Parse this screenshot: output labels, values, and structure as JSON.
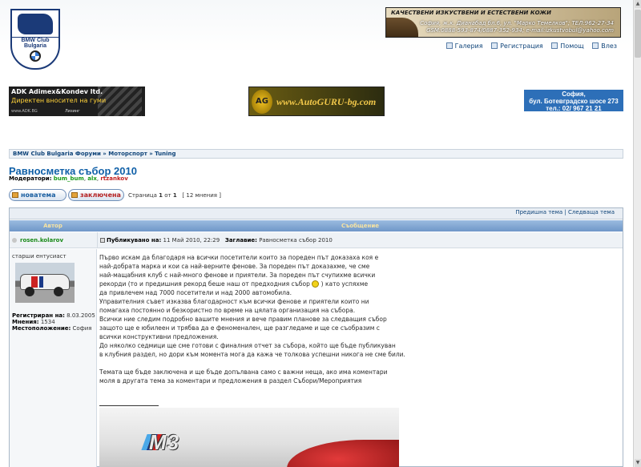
{
  "header": {
    "logo_line1": "BMW Club",
    "logo_line2": "Bulgaria",
    "ad_top": {
      "line1": "КАЧЕСТВЕНИ ИЗКУСТВЕНИ И ЕСТЕСТВЕНИ КОЖИ",
      "line2": "София, ж.к. Дианабад бл.6, ул. \"Марко Темелков\"; ТЕЛ:962-27-34",
      "line3": "GSM:0888-593-874/0887-352-934; e-mail:izkustvobul@yahoo.com"
    },
    "nav": [
      {
        "label": "Галерия",
        "icon": "gallery-icon"
      },
      {
        "label": "Регистрация",
        "icon": "register-icon"
      },
      {
        "label": "Помощ",
        "icon": "help-icon"
      },
      {
        "label": "Влез",
        "icon": "login-icon"
      }
    ]
  },
  "banners": {
    "adk": {
      "line1": "ADK Adimex&Kondev ltd.",
      "line2": "Директен вносител на гуми",
      "line3": "www.ADK.BG",
      "line4": "Лизинг"
    },
    "autoguru": {
      "logo": "AG",
      "url": "www.AutoGURU-bg.com"
    },
    "sofia": {
      "line1": "София,",
      "line2": "бул. Ботевградско шосе 273",
      "line3": "тел.: 02/ 967 21 21"
    }
  },
  "breadcrumb": {
    "items": [
      "BMW Club Bulgaria Форуми",
      "»",
      "Моторспорт",
      "»",
      "Tuning"
    ]
  },
  "topic": {
    "title": "Равносметка събор 2010",
    "moderators_label": "Модератори:",
    "moderators": [
      "bum_bum",
      "alx",
      "rtzankov"
    ],
    "new_topic_label": "новатема",
    "locked_label": "заключена",
    "pager_prefix": "Страница",
    "page_current": "1",
    "page_of": "от",
    "page_total": "1",
    "posts_count": "[ 12 мнения ]",
    "prev_topic": "Предишна тема",
    "next_topic": "Следваща тема",
    "nav_sep": "|"
  },
  "table": {
    "col_author": "Автор",
    "col_message": "Съобщение"
  },
  "post": {
    "author": "rosen.kolarov",
    "posted_label": "Публикувано на:",
    "posted_date": "11 Май 2010, 22:29",
    "subject_label": "Заглавие:",
    "subject": "Равносметка събор 2010",
    "rank": "старши ентусиаст",
    "registered_label": "Регистриран на:",
    "registered": "8.03.2005",
    "posts_label": "Мнения:",
    "posts": "1534",
    "location_label": "Местоположение:",
    "location": "София",
    "body": [
      "Първо искам да благодаря на всички посетители които за пореден път доказаха коя е",
      "най-добрата марка и кои са най-верните фенове. За пореден път доказахме, че сме",
      "най-мащабния клуб с най-много фенове и приятели. За пореден път счупихме всички",
      "рекорди (то и предишния рекорд беше наш от предходния събор",
      ") като успяхме",
      "да привлечем над 7000 посетители и над 2000 автомобила.",
      "Управителния съвет изказва благодарност към всички фенове и приятели които ни",
      "помагаха постоянно и безкористно по време на цялата организация на събора.",
      "Всички ние следим подробно вашите мнения и вече правим планове за следващия събор",
      "защото ще е юбилеен и трябва да е феноменален, ще разгледаме и ще се съобразим с",
      "всички конструктивни предложения.",
      "До няколко седмици ще сме готови с финалния отчет за събора, който ще бъде публикуван",
      "в клубния раздел, но дори към момента мога да кажа че толкова успешни никога не сме били.",
      "Темата ще бъде заключена и ще бъде допълвана само с важни неща, ако има коментари",
      "моля в другата тема за коментари и предложения в раздел Събори/Мероприятия"
    ],
    "photo_badge": "M3"
  }
}
